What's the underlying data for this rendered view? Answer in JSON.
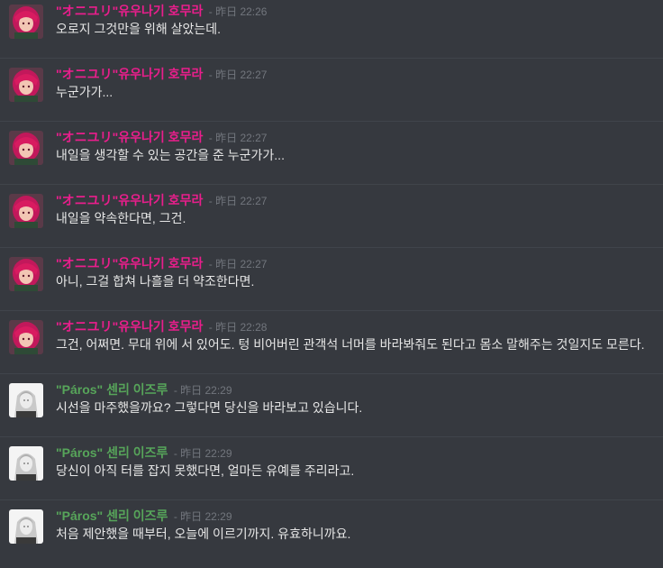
{
  "messages": [
    {
      "author": "\"オニユリ\"유우나기 호무라",
      "color": "#e91e8c",
      "avatar": "homura-avatar",
      "time": "- 昨日 22:26",
      "text": "오로지 그것만을 위해 살았는데."
    },
    {
      "author": "\"オニユリ\"유우나기 호무라",
      "color": "#e91e8c",
      "avatar": "homura-avatar",
      "time": "- 昨日 22:27",
      "text": "누군가가..."
    },
    {
      "author": "\"オニユリ\"유우나기 호무라",
      "color": "#e91e8c",
      "avatar": "homura-avatar",
      "time": "- 昨日 22:27",
      "text": "내일을 생각할 수 있는 공간을 준 누군가가..."
    },
    {
      "author": "\"オニユリ\"유우나기 호무라",
      "color": "#e91e8c",
      "avatar": "homura-avatar",
      "time": "- 昨日 22:27",
      "text": "내일을 약속한다면, 그건."
    },
    {
      "author": "\"オニユリ\"유우나기 호무라",
      "color": "#e91e8c",
      "avatar": "homura-avatar",
      "time": "- 昨日 22:27",
      "text": "아니, 그걸 합쳐 나흘을 더 약조한다면."
    },
    {
      "author": "\"オニユリ\"유우나기 호무라",
      "color": "#e91e8c",
      "avatar": "homura-avatar",
      "time": "- 昨日 22:28",
      "text": "그건, 어쩌면. 무대 위에 서 있어도. 텅 비어버린 관객석 너머를 바라봐줘도 된다고 몸소 말해주는 것일지도 모른다."
    },
    {
      "author": "\"Páros\" 센리 이즈루",
      "color": "#57a55a",
      "avatar": "izuru-avatar",
      "time": "- 昨日 22:29",
      "text": "시선을 마주했을까요? 그렇다면 당신을 바라보고 있습니다."
    },
    {
      "author": "\"Páros\" 센리 이즈루",
      "color": "#57a55a",
      "avatar": "izuru-avatar",
      "time": "- 昨日 22:29",
      "text": "당신이 아직 터를 잡지 못했다면, 얼마든 유예를 주리라고."
    },
    {
      "author": "\"Páros\" 센리 이즈루",
      "color": "#57a55a",
      "avatar": "izuru-avatar",
      "time": "- 昨日 22:29",
      "text": "처음 제안했을 때부터, 오늘에 이르기까지. 유효하니까요."
    }
  ]
}
